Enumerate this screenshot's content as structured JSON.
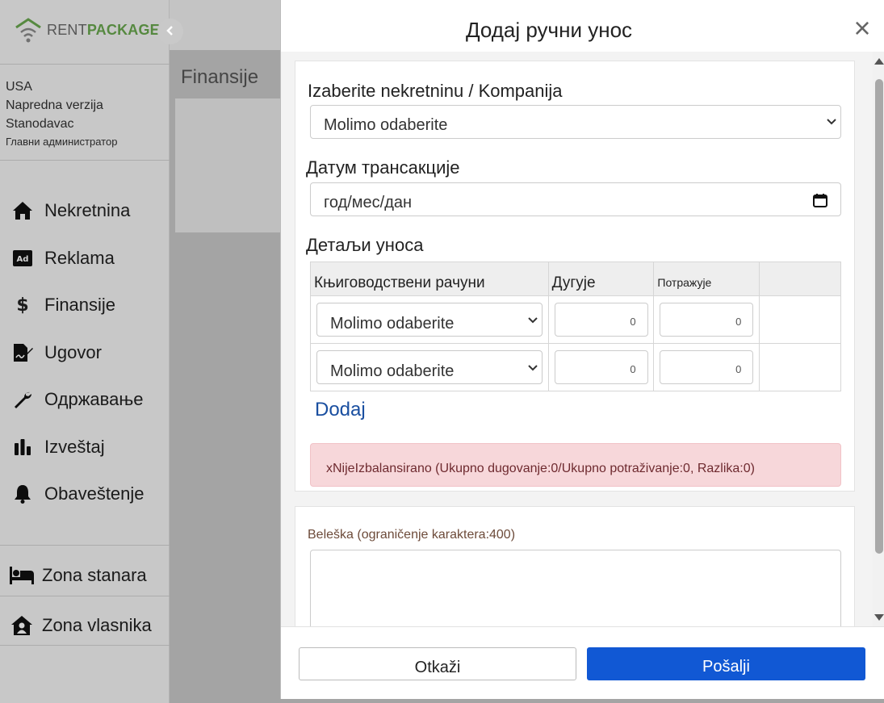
{
  "logo": {
    "part1": "RENT",
    "part2": "PACKAGE"
  },
  "user": {
    "country": "USA",
    "plan": "Napredna verzija",
    "role": "Stanodavac",
    "admin": "Главни администратор"
  },
  "nav": [
    {
      "label": "Nekretnina",
      "icon": "home-icon"
    },
    {
      "label": "Reklama",
      "icon": "ad-icon"
    },
    {
      "label": "Finansije",
      "icon": "dollar-icon"
    },
    {
      "label": "Ugovor",
      "icon": "contract-icon"
    },
    {
      "label": "Одржавање",
      "icon": "wrench-icon"
    },
    {
      "label": "Izveštaj",
      "icon": "chart-icon"
    },
    {
      "label": "Obaveštenje",
      "icon": "bell-icon"
    }
  ],
  "zones": {
    "tenant": "Zona stanara",
    "owner": "Zona vlasnika"
  },
  "main": {
    "title": "Finansije"
  },
  "modal": {
    "title": "Додај ручни унос",
    "property_label": "Izaberite nekretninu / Kompanija",
    "property_value": "Molimo odaberite",
    "date_label": "Датум трансакције",
    "date_placeholder": "год/мес/дан",
    "details_label": "Детаљи уноса",
    "table": {
      "col_accounts": "Књиговодствени рачуни",
      "col_debit": "Дугује",
      "col_credit": "Потражује",
      "rows": [
        {
          "account": "Molimo odaberite",
          "debit": "0",
          "credit": "0"
        },
        {
          "account": "Molimo odaberite",
          "debit": "0",
          "credit": "0"
        }
      ]
    },
    "add_link": "Dodaj",
    "alert": "xNijeIzbalansirano (Ukupno dugovanje:0/Ukupno potraživanje:0, Razlika:0)",
    "note_label": "Beleška (ograničenje karaktera:400)",
    "note_value": "",
    "cancel": "Otkaži",
    "send": "Pošalji"
  },
  "colors": {
    "brand_green": "#6aa84f",
    "primary": "#1158d4",
    "link": "#1a4fa0",
    "alert_bg": "#f7d7da"
  }
}
